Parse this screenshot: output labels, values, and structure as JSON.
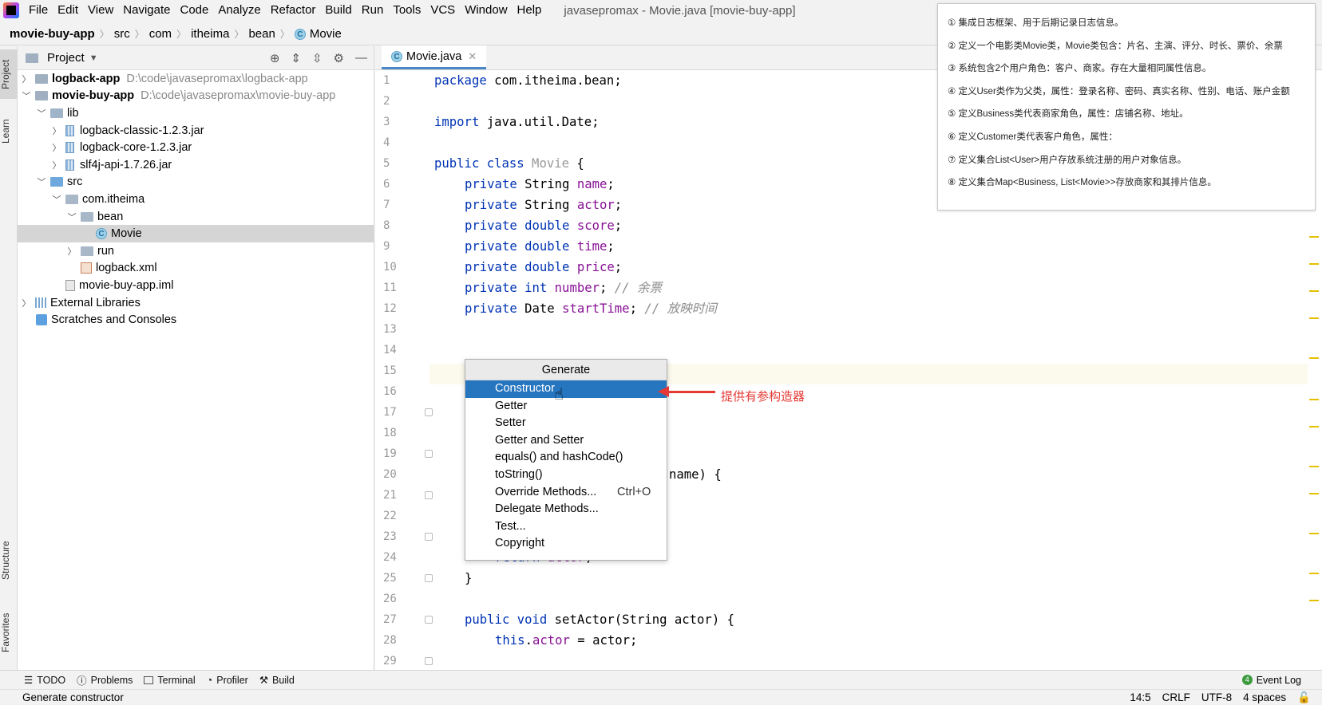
{
  "menubar": {
    "items": [
      "File",
      "Edit",
      "View",
      "Navigate",
      "Code",
      "Analyze",
      "Refactor",
      "Build",
      "Run",
      "Tools",
      "VCS",
      "Window",
      "Help"
    ],
    "window_title": "javasepromax - Movie.java [movie-buy-app]"
  },
  "breadcrumb": [
    "movie-buy-app",
    "src",
    "com",
    "itheima",
    "bean",
    "Movie"
  ],
  "left_stripe": {
    "project": "Project",
    "learn": "Learn",
    "structure": "Structure",
    "favorites": "Favorites"
  },
  "project_panel": {
    "title": "Project",
    "tree": [
      {
        "label": "logback-app",
        "path": "D:\\code\\javasepromax\\logback-app"
      },
      {
        "label": "movie-buy-app",
        "path": "D:\\code\\javasepromax\\movie-buy-app"
      },
      {
        "label": "lib"
      },
      {
        "label": "logback-classic-1.2.3.jar"
      },
      {
        "label": "logback-core-1.2.3.jar"
      },
      {
        "label": "slf4j-api-1.7.26.jar"
      },
      {
        "label": "src"
      },
      {
        "label": "com.itheima"
      },
      {
        "label": "bean"
      },
      {
        "label": "Movie"
      },
      {
        "label": "run"
      },
      {
        "label": "logback.xml"
      },
      {
        "label": "movie-buy-app.iml"
      },
      {
        "label": "External Libraries"
      },
      {
        "label": "Scratches and Consoles"
      }
    ]
  },
  "editor": {
    "tab": "Movie.java",
    "line_numbers": [
      "1",
      "2",
      "3",
      "4",
      "5",
      "6",
      "7",
      "8",
      "9",
      "10",
      "11",
      "12",
      "13",
      "14",
      "15",
      "16",
      "17",
      "18",
      "19",
      "20",
      "21",
      "22",
      "23",
      "24",
      "25",
      "26",
      "27",
      "28",
      "29"
    ],
    "code": {
      "l1_kw": "package",
      "l1_rest": " com.itheima.bean;",
      "l3_kw": "import",
      "l3_rest": " java.util.Date;",
      "l5_kw": "public class",
      "l5_cls": " Movie",
      "l5_rest": " {",
      "private": "private",
      "t_string": " String ",
      "t_double": " double ",
      "t_int": " int ",
      "t_date": " Date ",
      "f_name": "name",
      "f_actor": "actor",
      "f_score": "score",
      "f_time": "time",
      "f_price": "price",
      "f_number": "number",
      "f_start": "startTime",
      "semi": ";",
      "c_number": " // 余票",
      "c_start": " // 放映时间",
      "l20_rest": "name) {",
      "l25_kw": "return",
      "l25_fld": " actor",
      "l25_semi": ";",
      "l26": "}",
      "l28_kw": "public void",
      "l28_rest": " setActor(String actor) {",
      "l29_kw": "this",
      "l29_mid": ".",
      "l29_fld": "actor",
      "l29_rest": " = actor;"
    }
  },
  "generate_popup": {
    "title": "Generate",
    "items": [
      "Constructor",
      "Getter",
      "Setter",
      "Getter and Setter",
      "equals() and hashCode()",
      "toString()",
      "Override Methods...",
      "Delegate Methods...",
      "Test...",
      "Copyright"
    ],
    "shortcut": "Ctrl+O",
    "selected": "Constructor"
  },
  "annotation": {
    "text": "提供有参构造器",
    "color": "#e53935"
  },
  "notes": [
    "① 集成日志框架、用于后期记录日志信息。",
    "② 定义一个电影类Movie类，Movie类包含：片名、主演、评分、时长、票价、余票",
    "③ 系统包含2个用户角色：客户、商家。存在大量相同属性信息。",
    "④ 定义User类作为父类，属性：登录名称、密码、真实名称、性别、电话、账户金额",
    "⑤ 定义Business类代表商家角色，属性：店铺名称、地址。",
    "⑥ 定义Customer类代表客户角色，属性：",
    "⑦ 定义集合List<User>用户存放系统注册的用户对象信息。",
    "⑧ 定义集合Map<Business, List<Movie>>存放商家和其排片信息。"
  ],
  "bottom_tools": [
    "TODO",
    "Problems",
    "Terminal",
    "Profiler",
    "Build"
  ],
  "event_log": {
    "label": "Event Log",
    "count": "4"
  },
  "status": {
    "message": "Generate constructor",
    "position": "14:5",
    "line_sep": "CRLF",
    "encoding": "UTF-8",
    "indent": "4 spaces"
  }
}
